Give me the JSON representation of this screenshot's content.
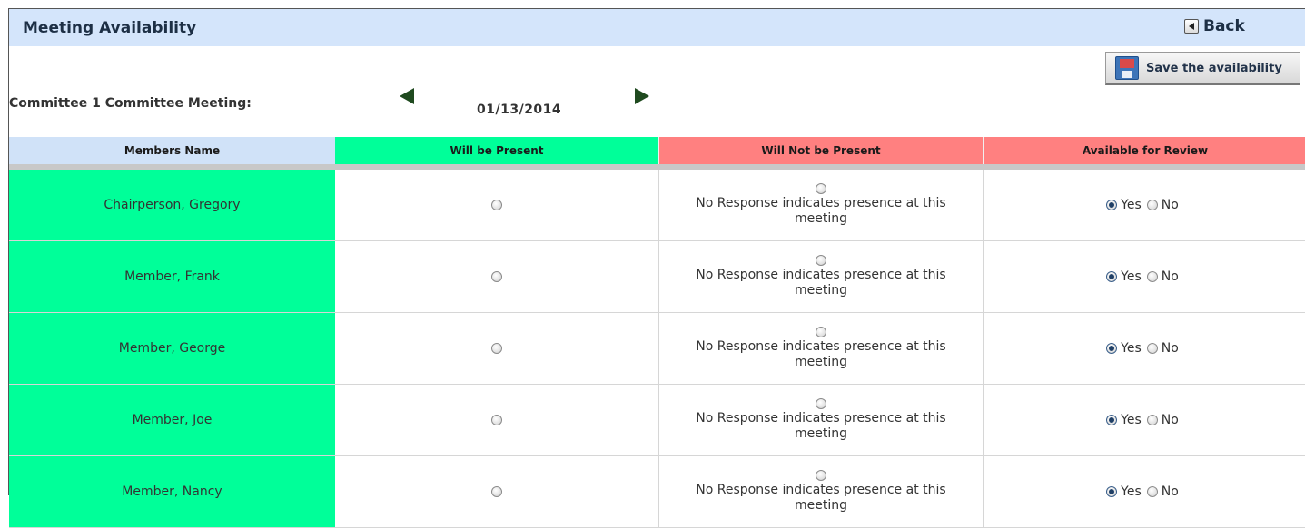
{
  "header": {
    "title": "Meeting Availability",
    "back_label": "Back"
  },
  "toolbar": {
    "save_label": "Save the availability"
  },
  "meeting": {
    "label": "Committee 1 Committee Meeting:",
    "date": "01/13/2014"
  },
  "table": {
    "columns": [
      "Members Name",
      "Will be Present",
      "Will Not be Present",
      "Available for Review"
    ],
    "no_response_note": "No Response indicates presence at this meeting",
    "yes_label": "Yes",
    "no_label": "No",
    "rows": [
      {
        "name": "Chairperson, Gregory",
        "will_be_present": false,
        "will_not_be_present": false,
        "available_for_review": "Yes"
      },
      {
        "name": "Member, Frank",
        "will_be_present": false,
        "will_not_be_present": false,
        "available_for_review": "Yes"
      },
      {
        "name": "Member, George",
        "will_be_present": false,
        "will_not_be_present": false,
        "available_for_review": "Yes"
      },
      {
        "name": "Member, Joe",
        "will_be_present": false,
        "will_not_be_present": false,
        "available_for_review": "Yes"
      },
      {
        "name": "Member, Nancy",
        "will_be_present": false,
        "will_not_be_present": false,
        "available_for_review": "Yes"
      }
    ]
  },
  "colors": {
    "header_bg": "#d4e5fb",
    "present_green": "#00ff99",
    "absent_red": "#ff8080"
  }
}
